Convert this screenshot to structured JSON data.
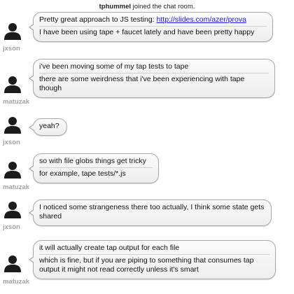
{
  "system": {
    "user": "tphummel",
    "text": " joined the chat room."
  },
  "messages": [
    {
      "user": "jxson",
      "lines": [
        {
          "text": "Pretty great approach to JS testing: ",
          "link": "http://slides.com/azer/prova"
        },
        {
          "text": "I have been using tape + faucet lately and have been pretty happy"
        }
      ]
    },
    {
      "user": "matuzak",
      "lines": [
        {
          "text": "i've been moving some of my tap tests to tape"
        },
        {
          "text": "there are some weirdness that i've been experiencing with tape though"
        }
      ]
    },
    {
      "user": "jxson",
      "lines": [
        {
          "text": "yeah?"
        }
      ]
    },
    {
      "user": "matuzak",
      "lines": [
        {
          "text": "so with file globs things get tricky"
        },
        {
          "text": "for example, tape tests/*.js"
        }
      ]
    },
    {
      "user": "jxson",
      "lines": [
        {
          "text": "I noticed some strangeness there too actually, I think some state gets shared"
        }
      ]
    },
    {
      "user": "matuzak",
      "lines": [
        {
          "text": "it will actually create tap output for each file"
        },
        {
          "text": "which is fine, but if you are piping to something that consumes tap output it might not read correctly unless it's smart"
        }
      ]
    }
  ]
}
